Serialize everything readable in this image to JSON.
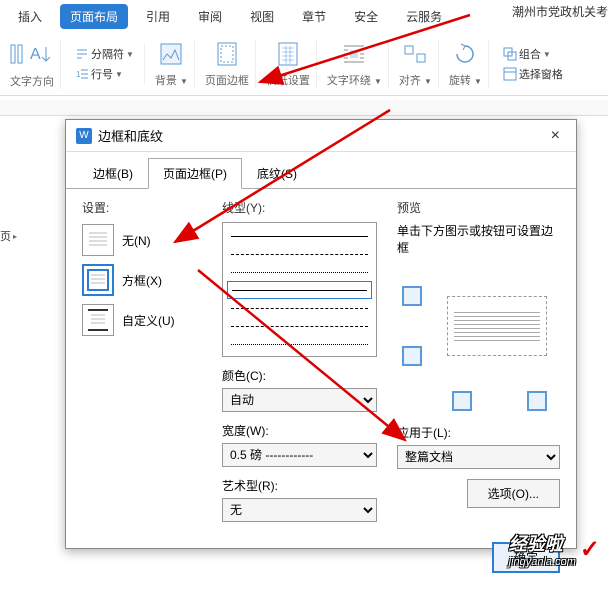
{
  "ribbon": {
    "tabs": [
      "插入",
      "页面布局",
      "引用",
      "审阅",
      "视图",
      "章节",
      "安全",
      "云服务"
    ],
    "active_tab": "页面布局",
    "clipped_text": "潮州市党政机关考",
    "groups": {
      "text_direction": "文字方向",
      "separator": "分隔符",
      "line_number": "行号",
      "background": "背景",
      "page_border": "页面边框",
      "paper_settings": "稿纸设置",
      "text_wrap": "文字环绕",
      "align": "对齐",
      "rotate": "旋转",
      "group": "组合",
      "select_pane": "选择窗格"
    }
  },
  "sidebar_item": "页",
  "dialog": {
    "title": "边框和底纹",
    "tabs": [
      "边框(B)",
      "页面边框(P)",
      "底纹(S)"
    ],
    "active_tab": "页面边框(P)",
    "settings_label": "设置:",
    "settings": {
      "none": "无(N)",
      "box": "方框(X)",
      "custom": "自定义(U)"
    },
    "linetype_label": "线型(Y):",
    "color_label": "颜色(C):",
    "color_value": "自动",
    "width_label": "宽度(W):",
    "width_value": "0.5 磅 ------------",
    "art_label": "艺术型(R):",
    "art_value": "无",
    "preview_label": "预览",
    "preview_hint": "单击下方图示或按钮可设置边框",
    "apply_label": "应用于(L):",
    "apply_value": "整篇文档",
    "options_button": "选项(O)...",
    "ok_button": "确定",
    "close_symbol": "×"
  },
  "watermark": {
    "text": "经验啦",
    "sub": "jingyanla.com",
    "check": "✓"
  }
}
